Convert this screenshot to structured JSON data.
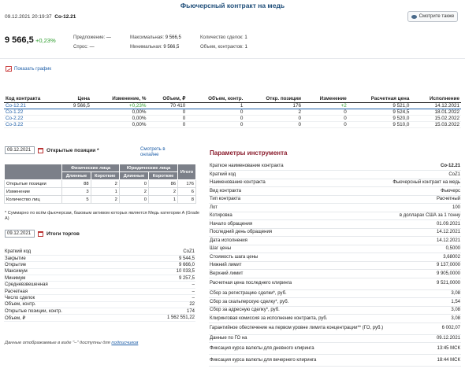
{
  "page": {
    "title": "Фьючерсный контракт на медь"
  },
  "header": {
    "datetime": "09.12.2021 20:19:37",
    "ticker": "Co-12.21",
    "watch_label": "Смотрите также"
  },
  "quote": {
    "price": "9 566,5",
    "change": "+0,23%",
    "offer_label": "Предложение:",
    "offer_value": "—",
    "bid_label": "Спрос:",
    "bid_value": "—",
    "max_label": "Максимальная:",
    "max_value": "9 566,5",
    "min_label": "Минимальная:",
    "min_value": "9 566,5",
    "trades_label": "Количество сделок:",
    "trades_value": "1",
    "volume_label": "Объем, контрактов:",
    "volume_value": "1"
  },
  "chart_link": "Показать график",
  "contracts": {
    "headers": [
      "Код контракта",
      "Цена",
      "Изменение, %",
      "Объем, ₽",
      "Объем, контр.",
      "Откр. позиции",
      "Изменение",
      "Расчетная цена",
      "Исполнение"
    ],
    "rows": [
      [
        "Co-12.21",
        "9 566,5",
        "+0,23%",
        "70 410",
        "1",
        "176",
        "+2",
        "9 521,0",
        "14.12.2021"
      ],
      [
        "Co-1.22",
        "",
        "0,00%",
        "0",
        "0",
        "2",
        "0",
        "9 524,5",
        "18.01.2022"
      ],
      [
        "Co-2.22",
        "",
        "0,00%",
        "0",
        "0",
        "0",
        "0",
        "9 520,0",
        "15.02.2022"
      ],
      [
        "Co-3.22",
        "",
        "0,00%",
        "0",
        "0",
        "0",
        "0",
        "9 510,0",
        "15.03.2022"
      ]
    ]
  },
  "positions": {
    "date": "09.12.2021",
    "title": "Открытые позиции *",
    "link": "Смотреть в онлайне",
    "group_phys": "Физические лица",
    "group_jur": "Юридические лица",
    "total": "Итого",
    "long": "Длинные",
    "short": "Короткие",
    "rows": [
      [
        "Открытые позиции",
        "88",
        "2",
        "0",
        "86",
        "176"
      ],
      [
        "Изменение",
        "3",
        "1",
        "2",
        "2",
        "6"
      ],
      [
        "Количество лиц",
        "5",
        "2",
        "0",
        "1",
        "8"
      ]
    ],
    "note": "* Суммарно по всём фьючерсам, базовым активом которых является Медь категории A (Grade A)"
  },
  "totals": {
    "date": "09.12.2021",
    "title": "Итоги торгов",
    "rows": [
      [
        "Краткий код",
        "CoZ1"
      ],
      [
        "Закрытие",
        "9 544,5"
      ],
      [
        "Открытие",
        "9 666,0"
      ],
      [
        "Максимум",
        "10 033,5"
      ],
      [
        "Минимум",
        "9 257,5"
      ],
      [
        "Средневзвешенная",
        "–"
      ],
      [
        "Расчетная",
        "–"
      ],
      [
        "Число сделок",
        "–"
      ],
      [
        "Объем, контр.",
        "22"
      ],
      [
        "Открытые позиции, контр.",
        "174"
      ],
      [
        "Объем, ₽",
        "1 562 551,22"
      ]
    ],
    "footnote_text": "Данные отображаемые в виде \"–\" доступны для",
    "footnote_link": "подписчиков"
  },
  "params": {
    "title": "Параметры инструмента",
    "rows": [
      [
        "Краткое наименование контракта",
        "Co-12.21"
      ],
      [
        "Краткий код",
        "CoZ1"
      ],
      [
        "Наименование контракта",
        "Фьючерсный контракт на медь"
      ],
      [
        "Вид контракта",
        "Фьючерс"
      ],
      [
        "Тип контракта",
        "Расчетный"
      ],
      [
        "Лот",
        "100"
      ],
      [
        "Котировка",
        "в долларах США за 1 тонну"
      ],
      [
        "Начало обращения",
        "01.09.2021"
      ],
      [
        "Последний день обращения",
        "14.12.2021"
      ],
      [
        "Дата исполнения",
        "14.12.2021"
      ],
      [
        "Шаг цены",
        "0,5000"
      ],
      [
        "Стоимость шага цены",
        "3,68002"
      ],
      [
        "Нижний лимит",
        "9 137,0000"
      ],
      [
        "Верхний лимит",
        "9 905,0000"
      ],
      [
        "Расчетная цена последнего клиринга",
        "9 521,0000"
      ],
      [
        "Сбор за регистрацию сделки*, руб.",
        "3,08"
      ],
      [
        "Сбор за скальперскую сделку*, руб.",
        "1,54"
      ],
      [
        "Сбор за адресную сделку*, руб.",
        "3,08"
      ],
      [
        "Клиринговая комиссия за исполнение контракта, руб.",
        "3,08"
      ],
      [
        "Гарантийное обеспечение на первом уровне лимита концентрации** (ГО, руб.)",
        "6 002,07"
      ],
      [
        "Данные по ГО на",
        "09.12.2021"
      ],
      [
        "Фиксация курса валюты для дневного клиринга",
        "13:45 МСК"
      ],
      [
        "Фиксация курса валюты для вечернего клиринга",
        "18:44 МСК"
      ]
    ]
  },
  "colors": {
    "brand_blue": "#1f4e79",
    "link": "#1f5fa8",
    "positive": "#2e9d2e",
    "params_title": "#8b1e2e",
    "table_head": "#7c8089"
  }
}
